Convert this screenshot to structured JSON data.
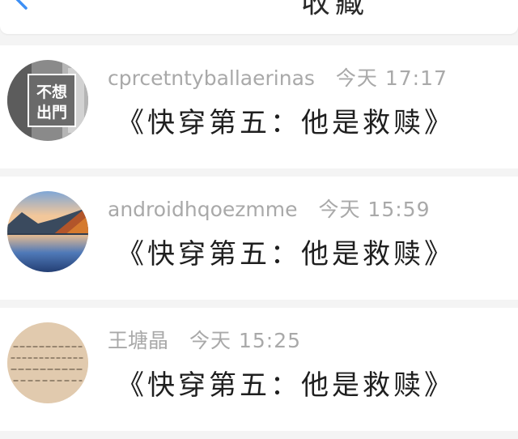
{
  "header": {
    "title": "收藏",
    "back_icon": "back-chevron-icon",
    "accent_color": "#3d8ff5"
  },
  "items": [
    {
      "username": "cprcetntyballaerinas",
      "time": "今天 17:17",
      "title": "《快穿第五：他是救赎》",
      "avatar_text": [
        "不想",
        "出門"
      ]
    },
    {
      "username": "androidhqoezmme",
      "time": "今天 15:59",
      "title": "《快穿第五：他是救赎》"
    },
    {
      "username": "王塘晶",
      "time": "今天 15:25",
      "title": "《快穿第五：他是救赎》"
    }
  ]
}
